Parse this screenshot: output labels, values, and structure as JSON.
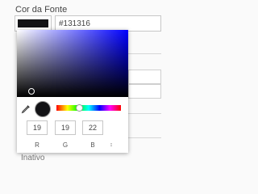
{
  "field": {
    "label": "Cor da Fonte",
    "hex_value": "#131316",
    "color": "#131316"
  },
  "picker": {
    "hue_color": "#0000ff",
    "rgb": {
      "r": "19",
      "g": "19",
      "b": "22"
    },
    "channel_labels": {
      "r": "R",
      "g": "G",
      "b": "B"
    },
    "mode_toggle": "↕"
  },
  "background": {
    "status_label": "Inativo"
  }
}
